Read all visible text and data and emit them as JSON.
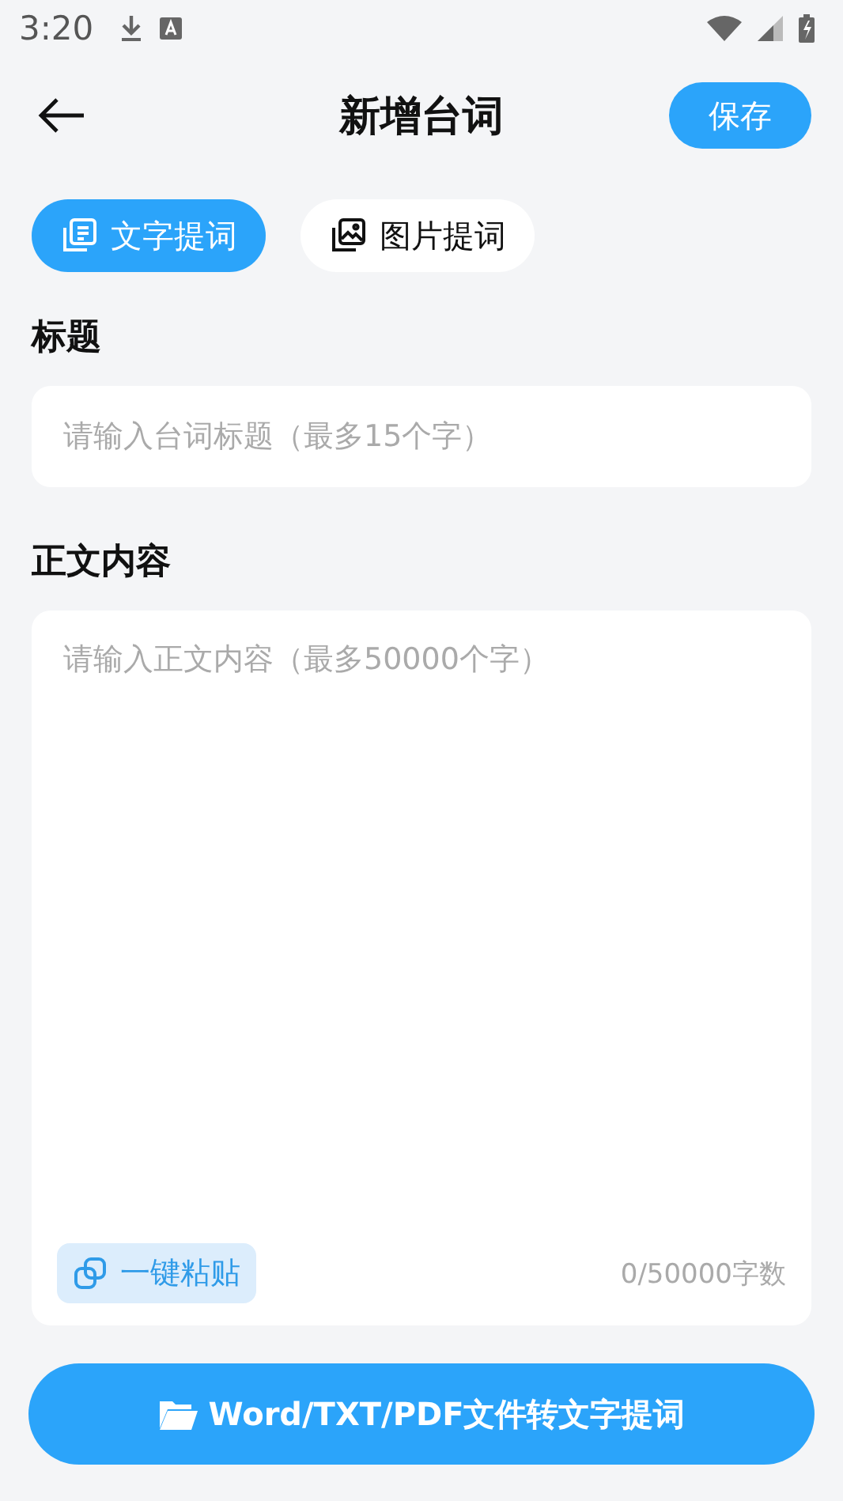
{
  "status_bar": {
    "time": "3:20"
  },
  "header": {
    "title": "新增台词",
    "save_button": "保存"
  },
  "tabs": [
    {
      "label": "文字提词",
      "selected": true,
      "kind": "text"
    },
    {
      "label": "图片提词",
      "selected": false,
      "kind": "image"
    }
  ],
  "title_field": {
    "label": "标题",
    "placeholder": "请输入台词标题（最多15个字）"
  },
  "body_field": {
    "label": "正文内容",
    "placeholder": "请输入正文内容（最多50000个字）",
    "paste_button": "一键粘贴",
    "counter": "0/50000字数"
  },
  "convert_button": "Word/TXT/PDF文件转文字提词"
}
